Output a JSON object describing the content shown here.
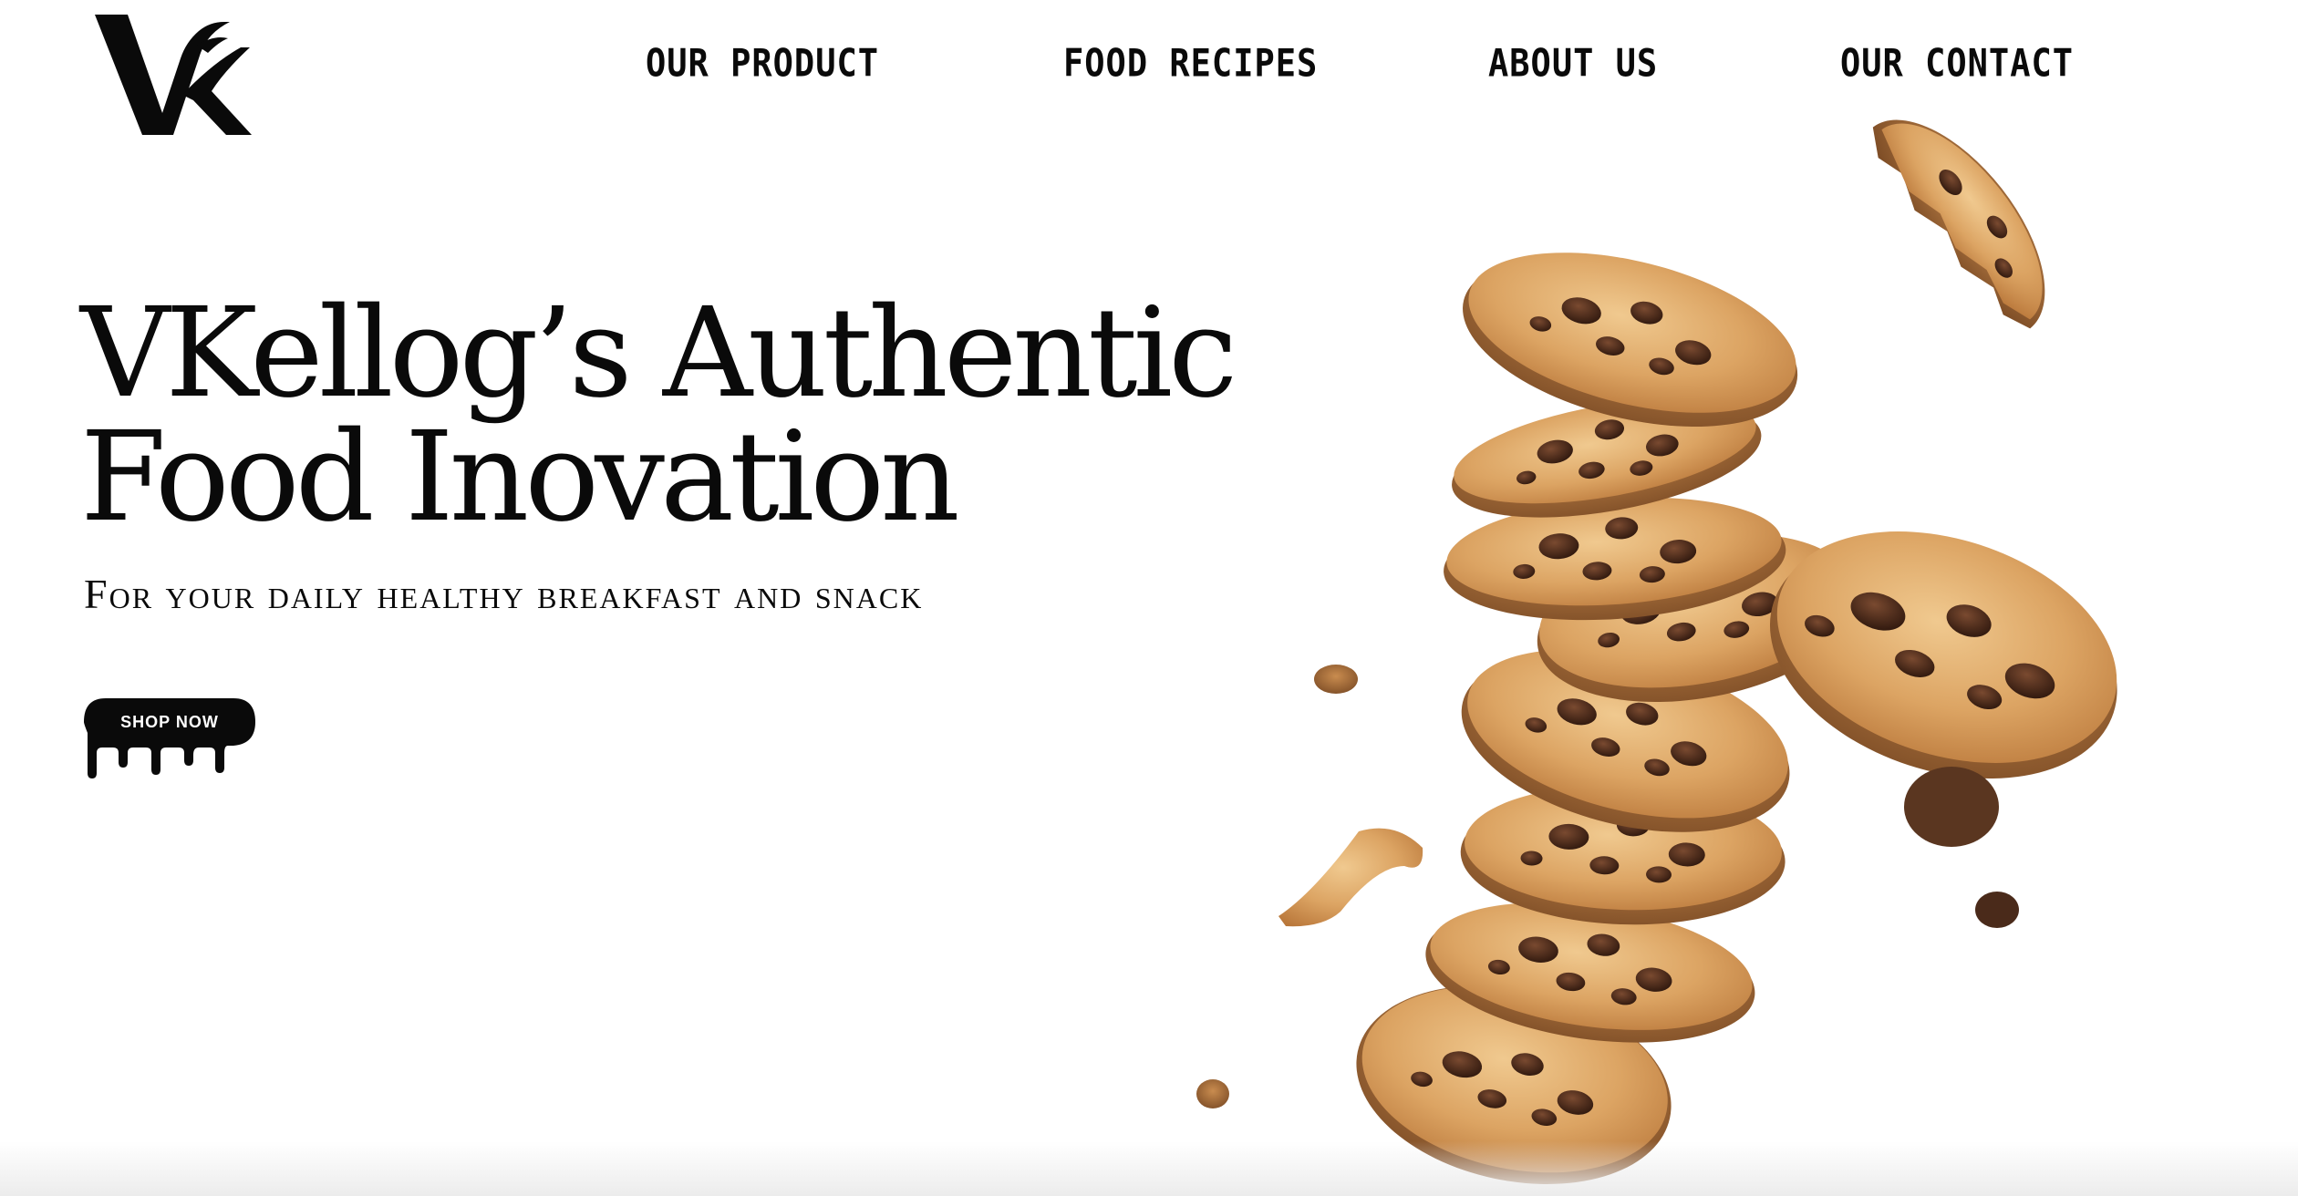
{
  "brand": {
    "logo_text": "VK"
  },
  "nav": {
    "items": [
      {
        "label": "OUR PRODUCT"
      },
      {
        "label": "FOOD RECIPES"
      },
      {
        "label": "ABOUT US"
      },
      {
        "label": "OUR CONTACT"
      }
    ]
  },
  "hero": {
    "title_line1": "VKellog’s Authentic",
    "title_line2": "Food Inovation",
    "subtitle": "For your daily healthy breakfast and snack",
    "cta_label": "SHOP NOW"
  },
  "colors": {
    "background": "#ffffff",
    "text": "#0a0a0a",
    "cookie_dough": "#d9a566",
    "chocolate": "#4a2a1a"
  },
  "illustration": {
    "icon": "chocolate-chip-cookie-stack"
  }
}
